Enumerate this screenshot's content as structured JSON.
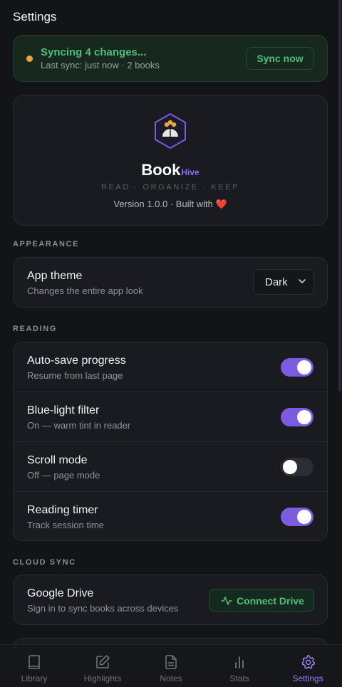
{
  "header": {
    "title": "Settings"
  },
  "sync": {
    "title": "Syncing 4 changes...",
    "subtitle": "Last sync: just now · 2 books",
    "button": "Sync now",
    "status_color": "#e8a93a"
  },
  "brand": {
    "name": "Book",
    "suffix": "Hive",
    "tagline": "READ · ORGANIZE · KEEP",
    "version_text": "Version 1.0.0 · Built with",
    "heart": "❤️"
  },
  "appearance": {
    "header": "APPEARANCE",
    "theme": {
      "title": "App theme",
      "subtitle": "Changes the entire app look",
      "value": "Dark"
    }
  },
  "reading": {
    "header": "READING",
    "items": [
      {
        "title": "Auto-save progress",
        "subtitle": "Resume from last page",
        "enabled": true
      },
      {
        "title": "Blue-light filter",
        "subtitle": "On — warm tint in reader",
        "enabled": true
      },
      {
        "title": "Scroll mode",
        "subtitle": "Off — page mode",
        "enabled": false
      },
      {
        "title": "Reading timer",
        "subtitle": "Track session time",
        "enabled": true
      }
    ]
  },
  "cloud": {
    "header": "CLOUD SYNC",
    "drive": {
      "title": "Google Drive",
      "subtitle": "Sign in to sync books across devices",
      "button": "Connect Drive"
    }
  },
  "nav": {
    "active": "settings",
    "items": [
      {
        "label": "Library",
        "icon": "book-icon"
      },
      {
        "label": "Highlights",
        "icon": "edit-icon"
      },
      {
        "label": "Notes",
        "icon": "file-text-icon"
      },
      {
        "label": "Stats",
        "icon": "bar-chart-icon"
      },
      {
        "label": "Settings",
        "icon": "gear-icon"
      }
    ]
  },
  "colors": {
    "accent": "#7b5ce0",
    "success": "#4fbf7a",
    "background": "#131418"
  }
}
